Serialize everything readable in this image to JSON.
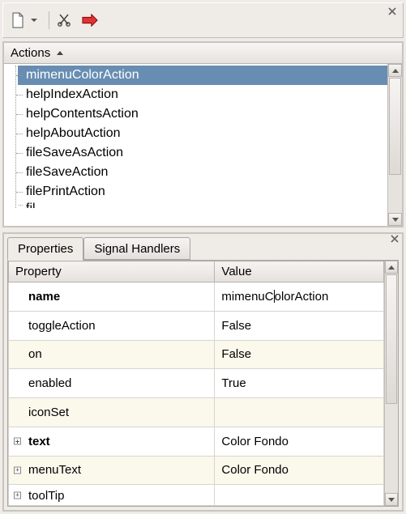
{
  "toolbar": {
    "icons": [
      "new-file-icon",
      "cut-icon",
      "go-icon"
    ]
  },
  "actions_panel": {
    "header": "Actions",
    "items": [
      {
        "label": "mimenuColorAction",
        "selected": true
      },
      {
        "label": "helpIndexAction",
        "selected": false
      },
      {
        "label": "helpContentsAction",
        "selected": false
      },
      {
        "label": "helpAboutAction",
        "selected": false
      },
      {
        "label": "fileSaveAsAction",
        "selected": false
      },
      {
        "label": "fileSaveAction",
        "selected": false
      },
      {
        "label": "filePrintAction",
        "selected": false
      }
    ],
    "partial_item": "fil"
  },
  "props_panel": {
    "tabs": [
      {
        "label": "Properties",
        "active": true
      },
      {
        "label": "Signal Handlers",
        "active": false
      }
    ],
    "columns": {
      "c0": "Property",
      "c1": "Value"
    },
    "rows": [
      {
        "name": "name",
        "value_pre": "mimenuC",
        "value_post": "olorAction",
        "bold": true,
        "alt": false,
        "exp": false,
        "editing": true
      },
      {
        "name": "toggleAction",
        "value": "False",
        "bold": false,
        "alt": false,
        "exp": false
      },
      {
        "name": "on",
        "value": "False",
        "bold": false,
        "alt": true,
        "exp": false
      },
      {
        "name": "enabled",
        "value": "True",
        "bold": false,
        "alt": false,
        "exp": false
      },
      {
        "name": "iconSet",
        "value": "",
        "bold": false,
        "alt": true,
        "exp": false
      },
      {
        "name": "text",
        "value": "Color Fondo",
        "bold": true,
        "alt": false,
        "exp": true
      },
      {
        "name": "menuText",
        "value": "Color Fondo",
        "bold": false,
        "alt": true,
        "exp": true
      },
      {
        "name": "toolTip",
        "value": "",
        "bold": false,
        "alt": false,
        "exp": true
      }
    ]
  }
}
